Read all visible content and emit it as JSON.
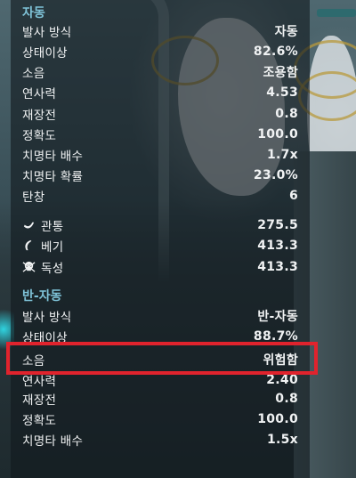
{
  "sections": [
    {
      "title": "자동",
      "rows": [
        {
          "label": "발사 방식",
          "value": "자동"
        },
        {
          "label": "상태이상",
          "value": "82.6%"
        },
        {
          "label": "소음",
          "value": "조용함"
        },
        {
          "label": "연사력",
          "value": "4.53"
        },
        {
          "label": "재장전",
          "value": "0.8"
        },
        {
          "label": "정확도",
          "value": "100.0"
        },
        {
          "label": "치명타 배수",
          "value": "1.7x"
        },
        {
          "label": "치명타 확률",
          "value": "23.0%"
        },
        {
          "label": "탄창",
          "value": "6"
        },
        {
          "label": "관통",
          "value": "275.5",
          "icon": "puncture-icon"
        },
        {
          "label": "베기",
          "value": "413.3",
          "icon": "slash-icon"
        },
        {
          "label": "독성",
          "value": "413.3",
          "icon": "toxin-skull-icon"
        }
      ]
    },
    {
      "title": "반-자동",
      "rows": [
        {
          "label": "발사 방식",
          "value": "반-자동"
        },
        {
          "label": "상태이상",
          "value": "88.7%"
        },
        {
          "label": "소음",
          "value": "위험함"
        },
        {
          "label": "연사력",
          "value": "2.40"
        },
        {
          "label": "재장전",
          "value": "0.8"
        },
        {
          "label": "정확도",
          "value": "100.0"
        },
        {
          "label": "치명타 배수",
          "value": "1.5x"
        }
      ]
    }
  ],
  "colors": {
    "section_title": "#7fc3d8",
    "highlight_border": "#e0232d",
    "text": "#f0f2f3"
  }
}
